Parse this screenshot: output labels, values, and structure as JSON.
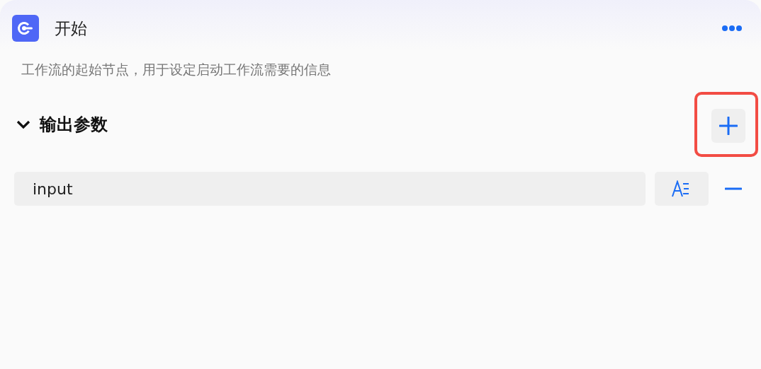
{
  "node": {
    "title": "开始",
    "description": "工作流的起始节点，用于设定启动工作流需要的信息"
  },
  "section": {
    "title": "输出参数",
    "expanded": true,
    "add_highlighted": true
  },
  "params": [
    {
      "value": "input"
    }
  ]
}
